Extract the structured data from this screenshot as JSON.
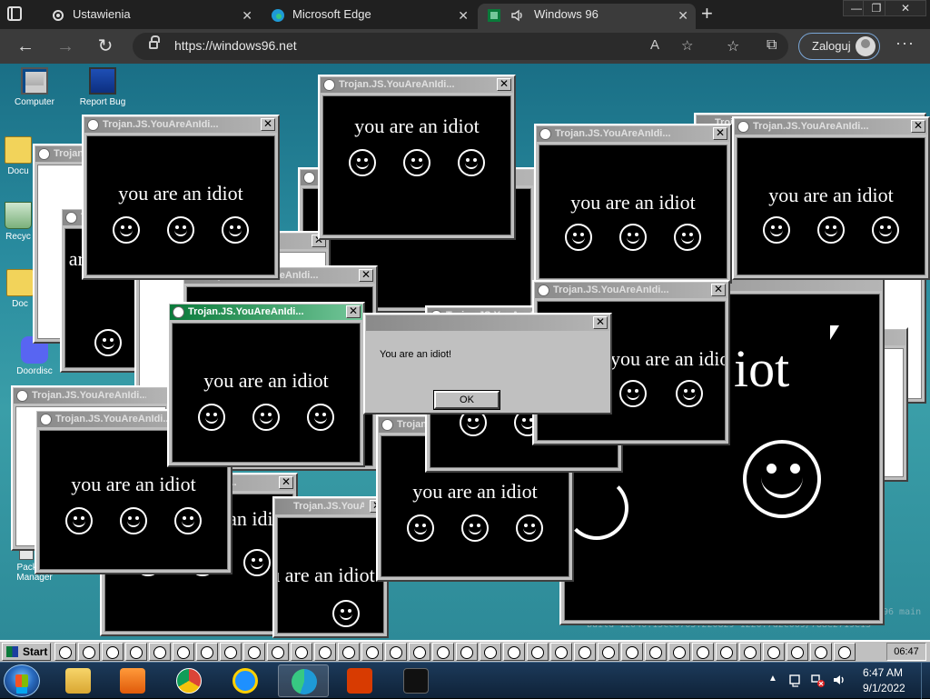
{
  "browser": {
    "tabs": [
      {
        "label": "Ustawienia",
        "icon": "gear-icon"
      },
      {
        "label": "Microsoft Edge",
        "icon": "edge-icon"
      },
      {
        "label": "Windows 96",
        "icon": "windows96-icon",
        "audio": "speaker-icon"
      }
    ],
    "close_glyph": "✕",
    "new_tab_glyph": "+",
    "url": "https://windows96.net",
    "login_label": "Zaloguj",
    "back_glyph": "←",
    "forward_glyph": "→",
    "refresh_glyph": "↻",
    "read_aloud_glyph": "A",
    "favorite_add_glyph": "☆",
    "favorites_glyph": "☆",
    "collections_glyph": "⧉",
    "menu_glyph": "···",
    "window_controls": {
      "minimize": "—",
      "restore": "❐",
      "close": "✕"
    }
  },
  "desktop": {
    "icons": [
      {
        "label": "Computer"
      },
      {
        "label": "Report Bug"
      },
      {
        "label": "Docu"
      },
      {
        "label": "Recyc"
      },
      {
        "label": "Doc"
      },
      {
        "label": "Doordisc"
      },
      {
        "label": "Package Manager"
      }
    ],
    "build_text": "build 12040.15cc0705.220829-1220.7d2c069/788e2719e13",
    "build_text2": "96 main"
  },
  "popup": {
    "title": "Trojan.JS.YouAreAnIdi...",
    "title_short": "Trojan.JS.YouAreAnIdi...",
    "message": "you are an idiot",
    "close_glyph": "✕"
  },
  "big_window": {
    "text": "iot"
  },
  "msgbox": {
    "text": "You are an idiot!",
    "ok_label": "OK"
  },
  "w96_taskbar": {
    "start_label": "Start",
    "clock": "06:47"
  },
  "win7_taskbar": {
    "time": "6:47 AM",
    "date": "9/1/2022",
    "tray_arrow": "▲"
  }
}
